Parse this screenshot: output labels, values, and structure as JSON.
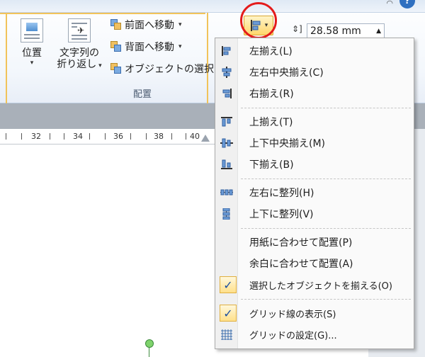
{
  "ribbon": {
    "position_label": "位置",
    "wrap_label_line1": "文字列の",
    "wrap_label_line2": "折り返し",
    "bring_forward_label": "前面へ移動",
    "send_backward_label": "背面へ移動",
    "selection_pane_label": "オブジェクトの選択と",
    "arrange_group_label": "配置",
    "height_value": "28.58 mm"
  },
  "ruler": {
    "numbers": [
      "32",
      "34",
      "36",
      "38",
      "40"
    ]
  },
  "menu": {
    "items": [
      {
        "label": "左揃え(L)",
        "icon": "align-left-icon"
      },
      {
        "label": "左右中央揃え(C)",
        "icon": "align-center-icon"
      },
      {
        "label": "右揃え(R)",
        "icon": "align-right-icon"
      },
      {
        "label": "上揃え(T)",
        "icon": "align-top-icon"
      },
      {
        "label": "上下中央揃え(M)",
        "icon": "align-middle-icon"
      },
      {
        "label": "下揃え(B)",
        "icon": "align-bottom-icon"
      },
      {
        "label": "左右に整列(H)",
        "icon": "distribute-horizontal-icon"
      },
      {
        "label": "上下に整列(V)",
        "icon": "distribute-vertical-icon"
      },
      {
        "label": "用紙に合わせて配置(P)",
        "icon": ""
      },
      {
        "label": "余白に合わせて配置(A)",
        "icon": ""
      },
      {
        "label": "選択したオブジェクトを揃える(O)",
        "icon": "check-icon",
        "checked": true
      },
      {
        "label": "グリッド線の表示(S)",
        "icon": "check-icon",
        "checked": true
      },
      {
        "label": "グリッドの設定(G)...",
        "icon": "grid-icon"
      }
    ]
  },
  "colors": {
    "highlight_circle": "#e41b1b",
    "ribbon_gold": "#f1c35a",
    "accent_blue": "#1b4fa0"
  }
}
